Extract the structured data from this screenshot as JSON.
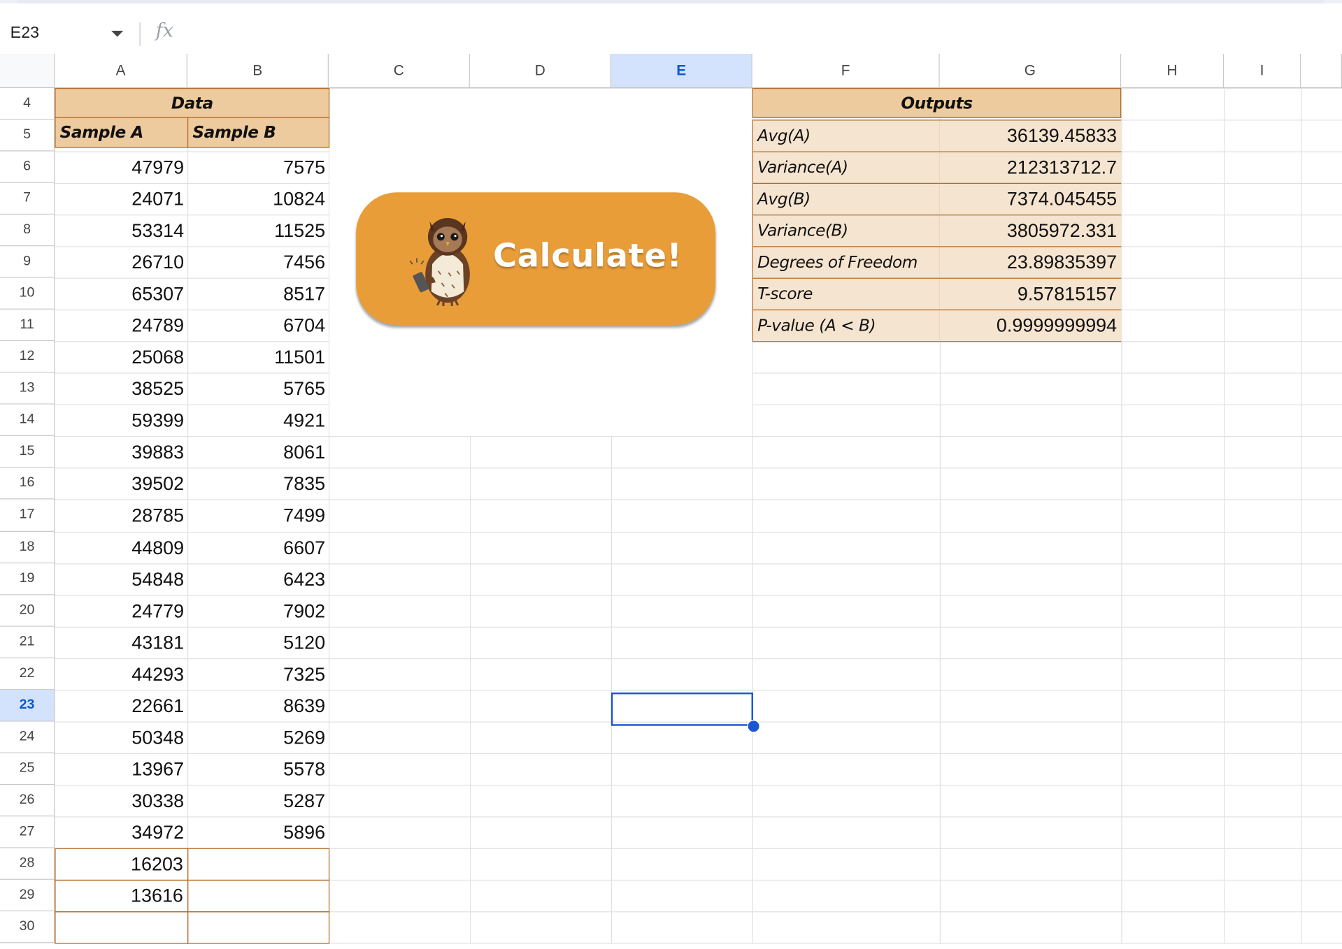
{
  "formula_bar": {
    "name_box": "E23",
    "fx_label": "fx",
    "formula": ""
  },
  "columns": [
    "A",
    "B",
    "C",
    "D",
    "E",
    "F",
    "G",
    "H",
    "I"
  ],
  "selected_column": "E",
  "rows": [
    "4",
    "5",
    "6",
    "7",
    "8",
    "9",
    "10",
    "11",
    "12",
    "13",
    "14",
    "15",
    "16",
    "17",
    "18",
    "19",
    "20",
    "21",
    "22",
    "23",
    "24",
    "25",
    "26",
    "27",
    "28",
    "29",
    "30"
  ],
  "selected_row": "23",
  "data_table": {
    "title": "Data",
    "col_a_header": "Sample A",
    "col_b_header": "Sample B",
    "sample_a": [
      "47979",
      "24071",
      "53314",
      "26710",
      "65307",
      "24789",
      "25068",
      "38525",
      "59399",
      "39883",
      "39502",
      "28785",
      "44809",
      "54848",
      "24779",
      "43181",
      "44293",
      "22661",
      "50348",
      "13967",
      "30338",
      "34972",
      "16203",
      "13616",
      ""
    ],
    "sample_b": [
      "7575",
      "10824",
      "11525",
      "7456",
      "8517",
      "6704",
      "11501",
      "5765",
      "4921",
      "8061",
      "7835",
      "7499",
      "6607",
      "6423",
      "7902",
      "5120",
      "7325",
      "8639",
      "5269",
      "5578",
      "5287",
      "5896",
      "",
      "",
      ""
    ]
  },
  "outputs": {
    "title": "Outputs",
    "labels": [
      "Avg(A)",
      "Variance(A)",
      "Avg(B)",
      "Variance(B)",
      "Degrees of Freedom",
      "T-score",
      "P-value (A < B)"
    ],
    "values": [
      "36139.45833",
      "212313712.7",
      "7374.045455",
      "3805972.331",
      "23.89835397",
      "9.57815157",
      "0.9999999994"
    ]
  },
  "button": {
    "label": "Calculate!",
    "icon": "owl-holding-phone-icon",
    "color": "#e89d39"
  },
  "selection": {
    "cell": "E23",
    "color": "#1a57d6"
  },
  "colors": {
    "header_tan": "#eecb9e",
    "cell_light_tan": "#f5e4cf",
    "border_brown": "#b36b25",
    "selected_header_bg": "#d3e3fd"
  }
}
